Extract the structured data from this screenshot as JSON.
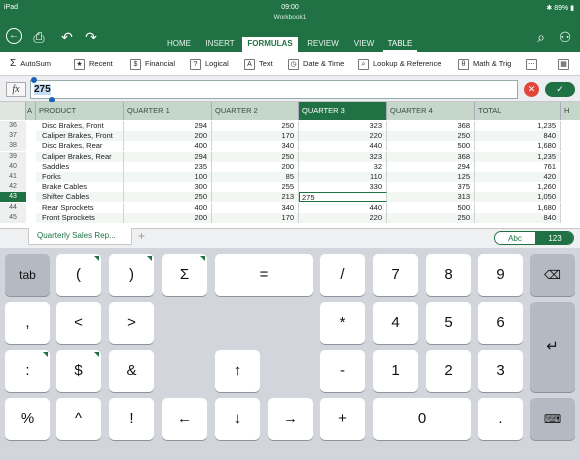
{
  "status": {
    "device": "iPad",
    "time": "09:00",
    "battery": "89%",
    "workbook": "Workbook1"
  },
  "tabs": [
    "HOME",
    "INSERT",
    "FORMULAS",
    "REVIEW",
    "VIEW",
    "TABLE"
  ],
  "ribbon": {
    "autosum": "AutoSum",
    "recent": "Recent",
    "financial": "Financial",
    "logical": "Logical",
    "text": "Text",
    "datetime": "Date & Time",
    "lookup": "Lookup & Reference",
    "math": "Math & Trig"
  },
  "formula_bar": {
    "fx_label": "fx",
    "value": "275"
  },
  "columns": {
    "a": "A",
    "product": "PRODUCT",
    "q1": "QUARTER 1",
    "q2": "QUARTER 2",
    "q3": "QUARTER 3",
    "q4": "QUARTER 4",
    "total": "TOTAL",
    "h": "H"
  },
  "rows": [
    {
      "n": "36",
      "product": "Disc Brakes, Front",
      "q1": "294",
      "q2": "250",
      "q3": "323",
      "q4": "368",
      "total": "1,235"
    },
    {
      "n": "37",
      "product": "Caliper Brakes, Front",
      "q1": "200",
      "q2": "170",
      "q3": "220",
      "q4": "250",
      "total": "840"
    },
    {
      "n": "38",
      "product": "Disc Brakes, Rear",
      "q1": "400",
      "q2": "340",
      "q3": "440",
      "q4": "500",
      "total": "1,680"
    },
    {
      "n": "39",
      "product": "Caliper Brakes, Rear",
      "q1": "294",
      "q2": "250",
      "q3": "323",
      "q4": "368",
      "total": "1,235"
    },
    {
      "n": "40",
      "product": "Saddles",
      "q1": "235",
      "q2": "200",
      "q3": "32",
      "q4": "294",
      "total": "761"
    },
    {
      "n": "41",
      "product": "Forks",
      "q1": "100",
      "q2": "85",
      "q3": "110",
      "q4": "125",
      "total": "420"
    },
    {
      "n": "42",
      "product": "Brake Cables",
      "q1": "300",
      "q2": "255",
      "q3": "330",
      "q4": "375",
      "total": "1,260"
    },
    {
      "n": "43",
      "product": "Shifter Cables",
      "q1": "250",
      "q2": "213",
      "q3": "275",
      "q4": "313",
      "total": "1,050"
    },
    {
      "n": "44",
      "product": "Rear Sprockets",
      "q1": "400",
      "q2": "340",
      "q3": "440",
      "q4": "500",
      "total": "1,680"
    },
    {
      "n": "45",
      "product": "Front Sprockets",
      "q1": "200",
      "q2": "170",
      "q3": "220",
      "q4": "250",
      "total": "840"
    }
  ],
  "sheet": {
    "tab": "Quarterly Sales Rep...",
    "add": "+"
  },
  "kb_toggle": {
    "abc": "Abc",
    "num": "123"
  },
  "keys": {
    "tab": "tab",
    "lparen": "(",
    "rparen": ")",
    "sigma": "Σ",
    "equals": "=",
    "slash": "/",
    "k7": "7",
    "k8": "8",
    "k9": "9",
    "comma": ",",
    "lt": "<",
    "gt": ">",
    "star": "*",
    "k4": "4",
    "k5": "5",
    "k6": "6",
    "colon": ":",
    "dollar": "$",
    "amp": "&",
    "up": "↑",
    "minus": "-",
    "k1": "1",
    "k2": "2",
    "k3": "3",
    "percent": "%",
    "caret": "^",
    "bang": "!",
    "left": "←",
    "down": "↓",
    "right": "→",
    "plus": "+",
    "k0": "0",
    "dot": "."
  },
  "colors": {
    "accent": "#207245",
    "cancel": "#e0473a"
  }
}
